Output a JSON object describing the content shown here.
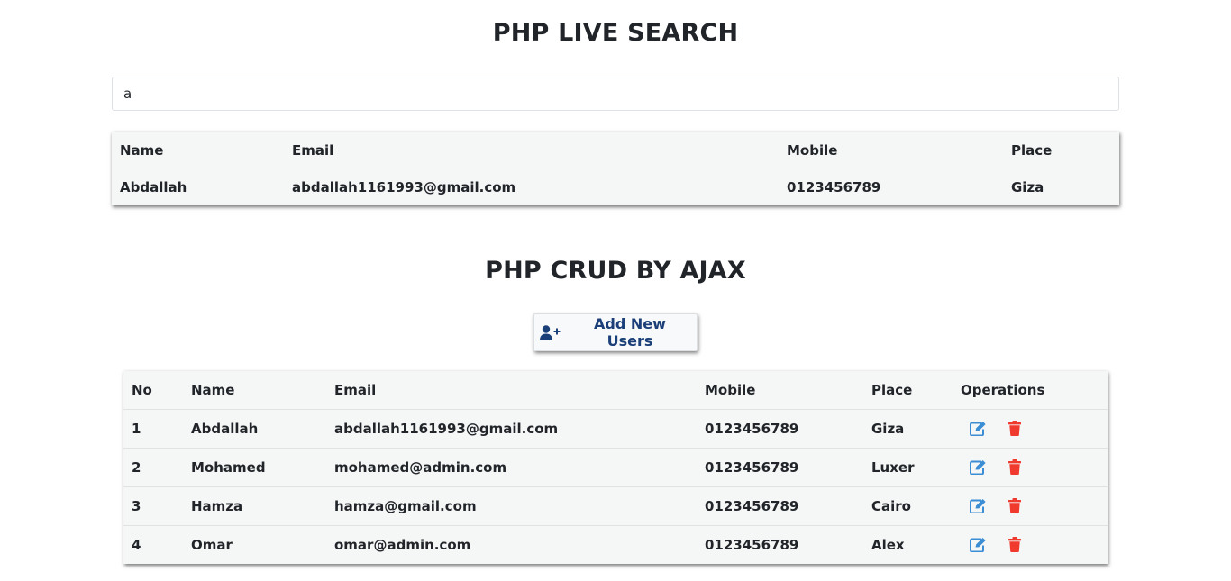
{
  "live_search": {
    "title": "PHP LIVE SEARCH",
    "input_value": "a",
    "columns": [
      "Name",
      "Email",
      "Mobile",
      "Place"
    ],
    "results": [
      {
        "name": "Abdallah",
        "email": "abdallah1161993@gmail.com",
        "mobile": "0123456789",
        "place": "Giza"
      }
    ]
  },
  "crud": {
    "title": "PHP CRUD BY AJAX",
    "add_button_label": "Add New Users",
    "add_button_icon": "user-plus-icon",
    "columns": [
      "No",
      "Name",
      "Email",
      "Mobile",
      "Place",
      "Operations"
    ],
    "rows": [
      {
        "no": "1",
        "name": "Abdallah",
        "email": "abdallah1161993@gmail.com",
        "mobile": "0123456789",
        "place": "Giza"
      },
      {
        "no": "2",
        "name": "Mohamed",
        "email": "mohamed@admin.com",
        "mobile": "0123456789",
        "place": "Luxer"
      },
      {
        "no": "3",
        "name": "Hamza",
        "email": "hamza@gmail.com",
        "mobile": "0123456789",
        "place": "Cairo"
      },
      {
        "no": "4",
        "name": "Omar",
        "email": "omar@admin.com",
        "mobile": "0123456789",
        "place": "Alex"
      }
    ],
    "edit_icon": "edit-icon",
    "delete_icon": "trash-icon"
  },
  "colors": {
    "edit": "#3b8ed4",
    "delete": "#f03a2e",
    "button_text": "#1b3f79"
  }
}
